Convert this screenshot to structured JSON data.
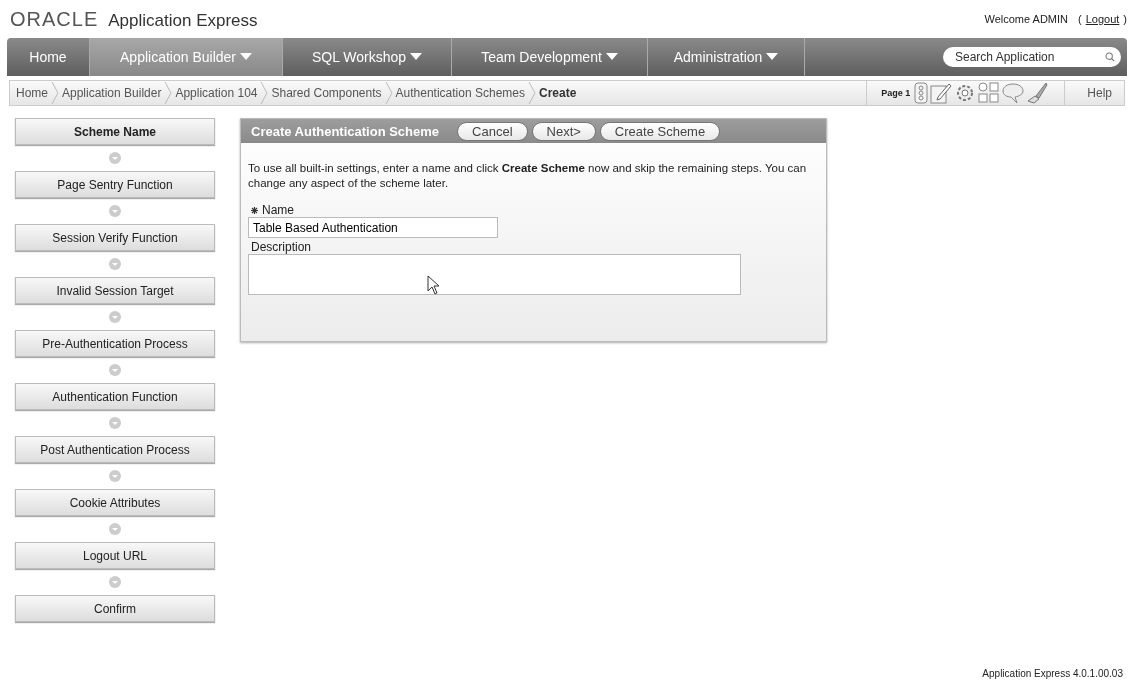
{
  "header": {
    "brand": "ORACLE",
    "product": "Application Express",
    "welcome": "Welcome ADMIN",
    "logout": "Logout",
    "paren_open": "(",
    "paren_close": ")"
  },
  "nav": {
    "tabs": [
      {
        "label": "Home",
        "selected": false,
        "has_menu": false
      },
      {
        "label": "Application Builder",
        "selected": true,
        "has_menu": true
      },
      {
        "label": "SQL Workshop",
        "selected": false,
        "has_menu": true
      },
      {
        "label": "Team Development",
        "selected": false,
        "has_menu": true
      },
      {
        "label": "Administration",
        "selected": false,
        "has_menu": true
      }
    ],
    "search": {
      "placeholder": "Search Application"
    }
  },
  "breadcrumbs": [
    {
      "label": "Home",
      "current": false
    },
    {
      "label": "Application Builder",
      "current": false
    },
    {
      "label": "Application 104",
      "current": false
    },
    {
      "label": "Shared Components",
      "current": false
    },
    {
      "label": "Authentication Schemes",
      "current": false
    },
    {
      "label": "Create",
      "current": true
    }
  ],
  "page_tools": {
    "page": "Page 1",
    "help": "Help"
  },
  "steps": [
    {
      "label": "Scheme Name",
      "selected": true
    },
    {
      "label": "Page Sentry Function",
      "selected": false
    },
    {
      "label": "Session Verify Function",
      "selected": false
    },
    {
      "label": "Invalid Session Target",
      "selected": false
    },
    {
      "label": "Pre-Authentication Process",
      "selected": false
    },
    {
      "label": "Authentication Function",
      "selected": false
    },
    {
      "label": "Post Authentication Process",
      "selected": false
    },
    {
      "label": "Cookie Attributes",
      "selected": false
    },
    {
      "label": "Logout URL",
      "selected": false
    },
    {
      "label": "Confirm",
      "selected": false
    }
  ],
  "region": {
    "title": "Create Authentication Scheme",
    "buttons": [
      "Cancel",
      "Next>",
      "Create Scheme"
    ],
    "instructions": "To use all built-in settings, enter a name and click **Create Scheme** now and skip the remaining steps. You can change any aspect of the scheme later.",
    "fields": [
      {
        "label": "Name",
        "required": true,
        "value": "Table Based Authentication",
        "kind": "text"
      },
      {
        "label": "Description",
        "required": false,
        "kind": "textarea"
      }
    ]
  },
  "footer": "Application Express 4.0.1.00.03"
}
